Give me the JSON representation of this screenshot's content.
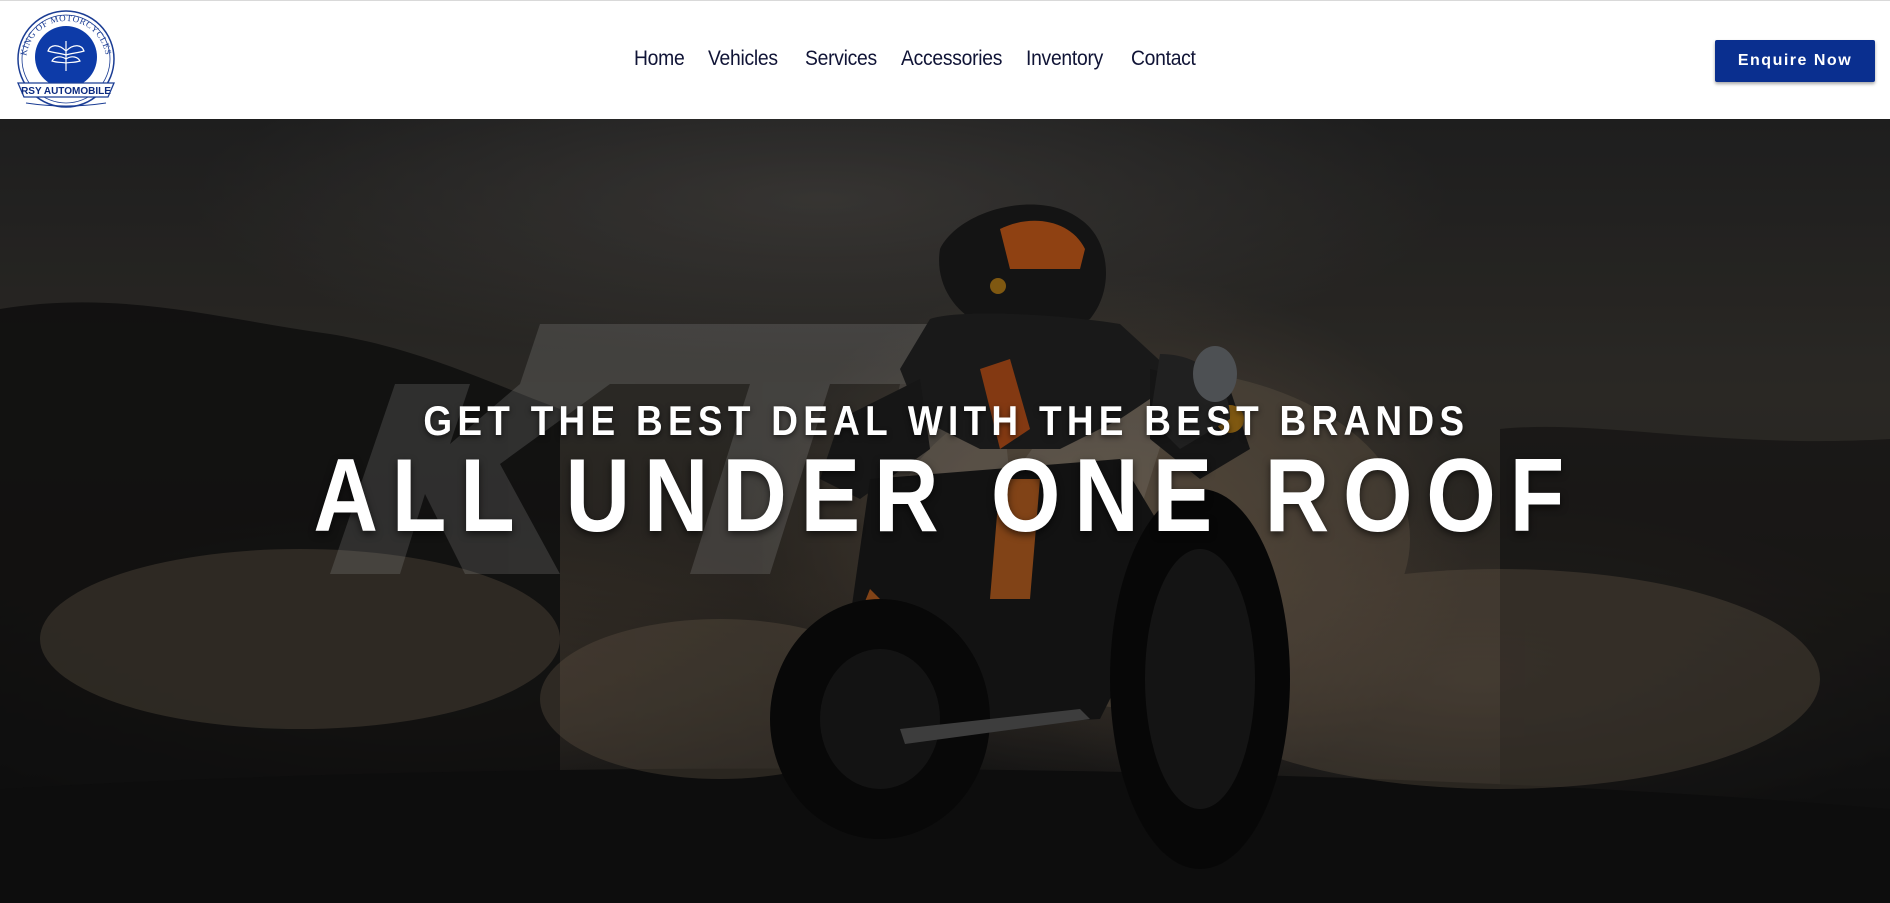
{
  "brand": {
    "arc_text": "KING OF MOTORCYCLES",
    "name": "RSY AUTOMOBILE",
    "primary_color": "#0a2f8f"
  },
  "nav": {
    "items": [
      {
        "label": "Home"
      },
      {
        "label": "Vehicles"
      },
      {
        "label": "Services"
      },
      {
        "label": "Accessories"
      },
      {
        "label": "Inventory"
      },
      {
        "label": "Contact"
      }
    ]
  },
  "header": {
    "cta_label": "Enquire Now"
  },
  "hero": {
    "subtitle": "GET THE BEST DEAL WITH THE BEST BRANDS",
    "title": "ALL UNDER ONE ROOF",
    "watermark": "KTM",
    "background": "motorcycle-rider-burnout-image"
  }
}
